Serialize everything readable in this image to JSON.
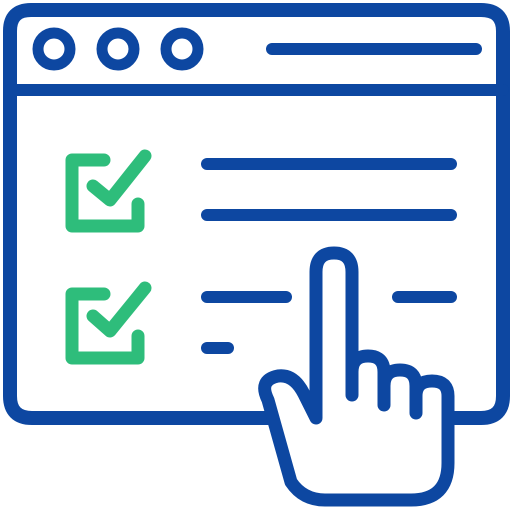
{
  "illustration": {
    "subject": "browser-checklist-tap-icon",
    "colors": {
      "primary": "#0D47A1",
      "accent": "#2EBD7B",
      "background": "#FFFFFF"
    },
    "icons": {
      "window": "browser-window-icon",
      "dots": "window-control-dot-icon",
      "checkbox": "checked-checkbox-icon",
      "hand": "pointing-hand-icon"
    },
    "checklist_items": [
      {
        "checked": true
      },
      {
        "checked": true
      }
    ]
  }
}
